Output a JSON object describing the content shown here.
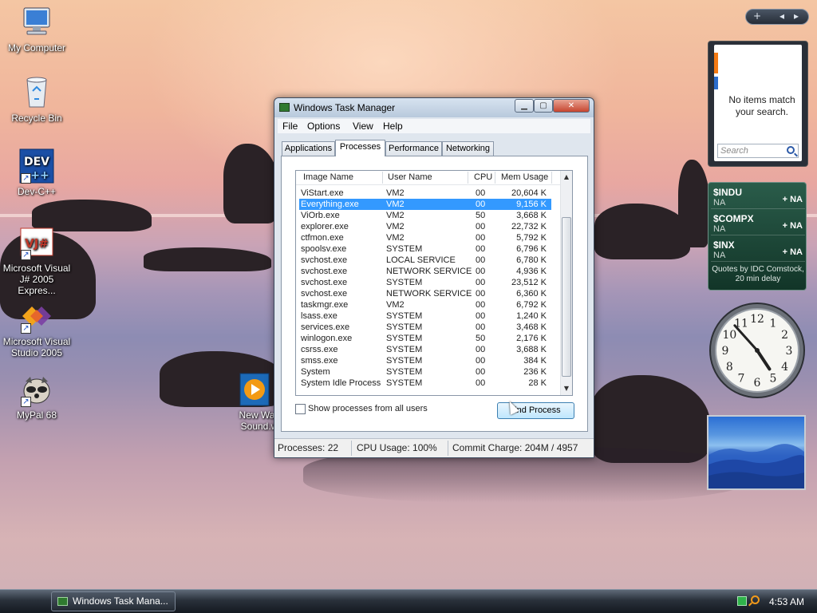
{
  "desktop_icons": [
    {
      "label": "My Computer",
      "icon": "computer-icon"
    },
    {
      "label": "Recycle Bin",
      "icon": "recycle-bin-icon"
    },
    {
      "label": "Dev-C++",
      "icon": "devcpp-icon",
      "badge": "DEV"
    },
    {
      "label": "Microsoft Visual J# 2005 Expres...",
      "icon": "visual-jsharp-icon",
      "badge": "VJ#"
    },
    {
      "label": "Microsoft Visual Studio 2005",
      "icon": "visual-studio-icon"
    },
    {
      "label": "MyPal 68",
      "icon": "mypal-icon"
    },
    {
      "label": "New Wav Sound.w",
      "icon": "media-file-icon"
    }
  ],
  "task_manager": {
    "title": "Windows Task Manager",
    "caption_buttons": {
      "minimize": "▁",
      "maximize": "▢",
      "close": "✕"
    },
    "menu": [
      "File",
      "Options",
      "View",
      "Help"
    ],
    "tabs": [
      "Applications",
      "Processes",
      "Performance",
      "Networking"
    ],
    "active_tab": "Processes",
    "columns": [
      "Image Name",
      "User Name",
      "CPU",
      "Mem Usage"
    ],
    "processes": [
      {
        "image": "ViStart.exe",
        "user": "VM2",
        "cpu": "00",
        "mem": "20,604 K",
        "selected": false
      },
      {
        "image": "Everything.exe",
        "user": "VM2",
        "cpu": "00",
        "mem": "9,156 K",
        "selected": true
      },
      {
        "image": "ViOrb.exe",
        "user": "VM2",
        "cpu": "50",
        "mem": "3,668 K",
        "selected": false
      },
      {
        "image": "explorer.exe",
        "user": "VM2",
        "cpu": "00",
        "mem": "22,732 K",
        "selected": false
      },
      {
        "image": "ctfmon.exe",
        "user": "VM2",
        "cpu": "00",
        "mem": "5,792 K",
        "selected": false
      },
      {
        "image": "spoolsv.exe",
        "user": "SYSTEM",
        "cpu": "00",
        "mem": "6,796 K",
        "selected": false
      },
      {
        "image": "svchost.exe",
        "user": "LOCAL SERVICE",
        "cpu": "00",
        "mem": "6,780 K",
        "selected": false
      },
      {
        "image": "svchost.exe",
        "user": "NETWORK SERVICE",
        "cpu": "00",
        "mem": "4,936 K",
        "selected": false
      },
      {
        "image": "svchost.exe",
        "user": "SYSTEM",
        "cpu": "00",
        "mem": "23,512 K",
        "selected": false
      },
      {
        "image": "svchost.exe",
        "user": "NETWORK SERVICE",
        "cpu": "00",
        "mem": "6,360 K",
        "selected": false
      },
      {
        "image": "taskmgr.exe",
        "user": "VM2",
        "cpu": "00",
        "mem": "6,792 K",
        "selected": false
      },
      {
        "image": "lsass.exe",
        "user": "SYSTEM",
        "cpu": "00",
        "mem": "1,240 K",
        "selected": false
      },
      {
        "image": "services.exe",
        "user": "SYSTEM",
        "cpu": "00",
        "mem": "3,468 K",
        "selected": false
      },
      {
        "image": "winlogon.exe",
        "user": "SYSTEM",
        "cpu": "50",
        "mem": "2,176 K",
        "selected": false
      },
      {
        "image": "csrss.exe",
        "user": "SYSTEM",
        "cpu": "00",
        "mem": "3,688 K",
        "selected": false
      },
      {
        "image": "smss.exe",
        "user": "SYSTEM",
        "cpu": "00",
        "mem": "384 K",
        "selected": false
      },
      {
        "image": "System",
        "user": "SYSTEM",
        "cpu": "00",
        "mem": "236 K",
        "selected": false
      },
      {
        "image": "System Idle Process",
        "user": "SYSTEM",
        "cpu": "00",
        "mem": "28 K",
        "selected": false
      }
    ],
    "show_all_label": "Show processes from all users",
    "show_all_checked": false,
    "end_process_label": "End Process",
    "status": {
      "processes": "Processes: 22",
      "cpu": "CPU Usage: 100%",
      "commit": "Commit Charge: 204M / 4957"
    }
  },
  "sidebar": {
    "toolbar": {
      "add": "+",
      "prev": "◂",
      "next": "▸"
    },
    "search": {
      "message": "No items match your search.",
      "placeholder": "Search"
    },
    "stocks": [
      {
        "symbol": "$INDU",
        "value": "NA",
        "change": "+ NA"
      },
      {
        "symbol": "$COMPX",
        "value": "NA",
        "change": "+ NA"
      },
      {
        "symbol": "$INX",
        "value": "NA",
        "change": "+ NA"
      }
    ],
    "stocks_credit": "Quotes by IDC Comstock, 20 min delay",
    "clock": {
      "hour": 4,
      "minute": 53
    },
    "clock_numbers": [
      "12",
      "1",
      "2",
      "3",
      "4",
      "5",
      "6",
      "7",
      "8",
      "9",
      "10",
      "11"
    ]
  },
  "taskbar": {
    "active_window": "Windows Task Mana...",
    "time": "4:53 AM"
  },
  "colors": {
    "selection": "#3399ff",
    "titlebar": "#b8c9dc",
    "taskbar": "#1a1f27",
    "stocks_bg": "#1f4a3a"
  }
}
